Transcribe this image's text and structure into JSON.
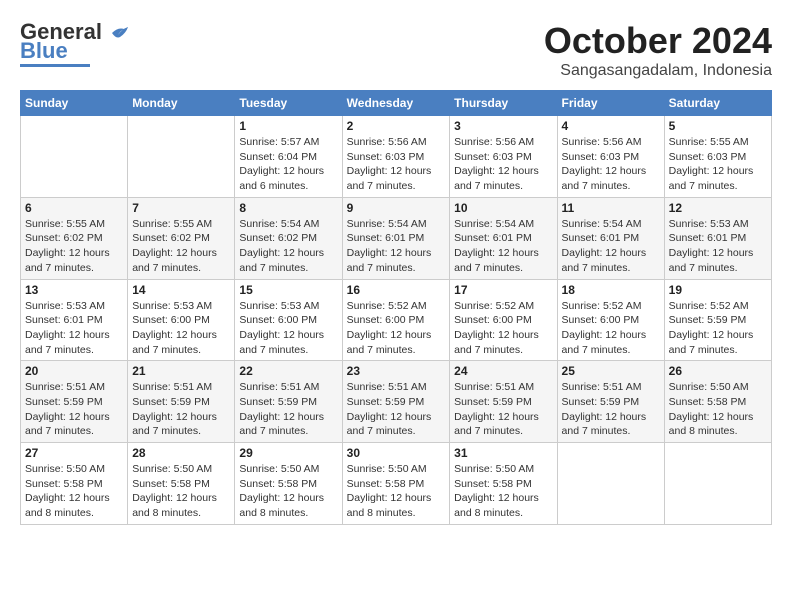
{
  "header": {
    "logo_line1": "General",
    "logo_line2": "Blue",
    "month": "October 2024",
    "location": "Sangasangadalam, Indonesia"
  },
  "weekdays": [
    "Sunday",
    "Monday",
    "Tuesday",
    "Wednesday",
    "Thursday",
    "Friday",
    "Saturday"
  ],
  "weeks": [
    [
      {
        "day": "",
        "content": ""
      },
      {
        "day": "",
        "content": ""
      },
      {
        "day": "1",
        "content": "Sunrise: 5:57 AM\nSunset: 6:04 PM\nDaylight: 12 hours\nand 6 minutes."
      },
      {
        "day": "2",
        "content": "Sunrise: 5:56 AM\nSunset: 6:03 PM\nDaylight: 12 hours\nand 7 minutes."
      },
      {
        "day": "3",
        "content": "Sunrise: 5:56 AM\nSunset: 6:03 PM\nDaylight: 12 hours\nand 7 minutes."
      },
      {
        "day": "4",
        "content": "Sunrise: 5:56 AM\nSunset: 6:03 PM\nDaylight: 12 hours\nand 7 minutes."
      },
      {
        "day": "5",
        "content": "Sunrise: 5:55 AM\nSunset: 6:03 PM\nDaylight: 12 hours\nand 7 minutes."
      }
    ],
    [
      {
        "day": "6",
        "content": "Sunrise: 5:55 AM\nSunset: 6:02 PM\nDaylight: 12 hours\nand 7 minutes."
      },
      {
        "day": "7",
        "content": "Sunrise: 5:55 AM\nSunset: 6:02 PM\nDaylight: 12 hours\nand 7 minutes."
      },
      {
        "day": "8",
        "content": "Sunrise: 5:54 AM\nSunset: 6:02 PM\nDaylight: 12 hours\nand 7 minutes."
      },
      {
        "day": "9",
        "content": "Sunrise: 5:54 AM\nSunset: 6:01 PM\nDaylight: 12 hours\nand 7 minutes."
      },
      {
        "day": "10",
        "content": "Sunrise: 5:54 AM\nSunset: 6:01 PM\nDaylight: 12 hours\nand 7 minutes."
      },
      {
        "day": "11",
        "content": "Sunrise: 5:54 AM\nSunset: 6:01 PM\nDaylight: 12 hours\nand 7 minutes."
      },
      {
        "day": "12",
        "content": "Sunrise: 5:53 AM\nSunset: 6:01 PM\nDaylight: 12 hours\nand 7 minutes."
      }
    ],
    [
      {
        "day": "13",
        "content": "Sunrise: 5:53 AM\nSunset: 6:01 PM\nDaylight: 12 hours\nand 7 minutes."
      },
      {
        "day": "14",
        "content": "Sunrise: 5:53 AM\nSunset: 6:00 PM\nDaylight: 12 hours\nand 7 minutes."
      },
      {
        "day": "15",
        "content": "Sunrise: 5:53 AM\nSunset: 6:00 PM\nDaylight: 12 hours\nand 7 minutes."
      },
      {
        "day": "16",
        "content": "Sunrise: 5:52 AM\nSunset: 6:00 PM\nDaylight: 12 hours\nand 7 minutes."
      },
      {
        "day": "17",
        "content": "Sunrise: 5:52 AM\nSunset: 6:00 PM\nDaylight: 12 hours\nand 7 minutes."
      },
      {
        "day": "18",
        "content": "Sunrise: 5:52 AM\nSunset: 6:00 PM\nDaylight: 12 hours\nand 7 minutes."
      },
      {
        "day": "19",
        "content": "Sunrise: 5:52 AM\nSunset: 5:59 PM\nDaylight: 12 hours\nand 7 minutes."
      }
    ],
    [
      {
        "day": "20",
        "content": "Sunrise: 5:51 AM\nSunset: 5:59 PM\nDaylight: 12 hours\nand 7 minutes."
      },
      {
        "day": "21",
        "content": "Sunrise: 5:51 AM\nSunset: 5:59 PM\nDaylight: 12 hours\nand 7 minutes."
      },
      {
        "day": "22",
        "content": "Sunrise: 5:51 AM\nSunset: 5:59 PM\nDaylight: 12 hours\nand 7 minutes."
      },
      {
        "day": "23",
        "content": "Sunrise: 5:51 AM\nSunset: 5:59 PM\nDaylight: 12 hours\nand 7 minutes."
      },
      {
        "day": "24",
        "content": "Sunrise: 5:51 AM\nSunset: 5:59 PM\nDaylight: 12 hours\nand 7 minutes."
      },
      {
        "day": "25",
        "content": "Sunrise: 5:51 AM\nSunset: 5:59 PM\nDaylight: 12 hours\nand 7 minutes."
      },
      {
        "day": "26",
        "content": "Sunrise: 5:50 AM\nSunset: 5:58 PM\nDaylight: 12 hours\nand 8 minutes."
      }
    ],
    [
      {
        "day": "27",
        "content": "Sunrise: 5:50 AM\nSunset: 5:58 PM\nDaylight: 12 hours\nand 8 minutes."
      },
      {
        "day": "28",
        "content": "Sunrise: 5:50 AM\nSunset: 5:58 PM\nDaylight: 12 hours\nand 8 minutes."
      },
      {
        "day": "29",
        "content": "Sunrise: 5:50 AM\nSunset: 5:58 PM\nDaylight: 12 hours\nand 8 minutes."
      },
      {
        "day": "30",
        "content": "Sunrise: 5:50 AM\nSunset: 5:58 PM\nDaylight: 12 hours\nand 8 minutes."
      },
      {
        "day": "31",
        "content": "Sunrise: 5:50 AM\nSunset: 5:58 PM\nDaylight: 12 hours\nand 8 minutes."
      },
      {
        "day": "",
        "content": ""
      },
      {
        "day": "",
        "content": ""
      }
    ]
  ]
}
